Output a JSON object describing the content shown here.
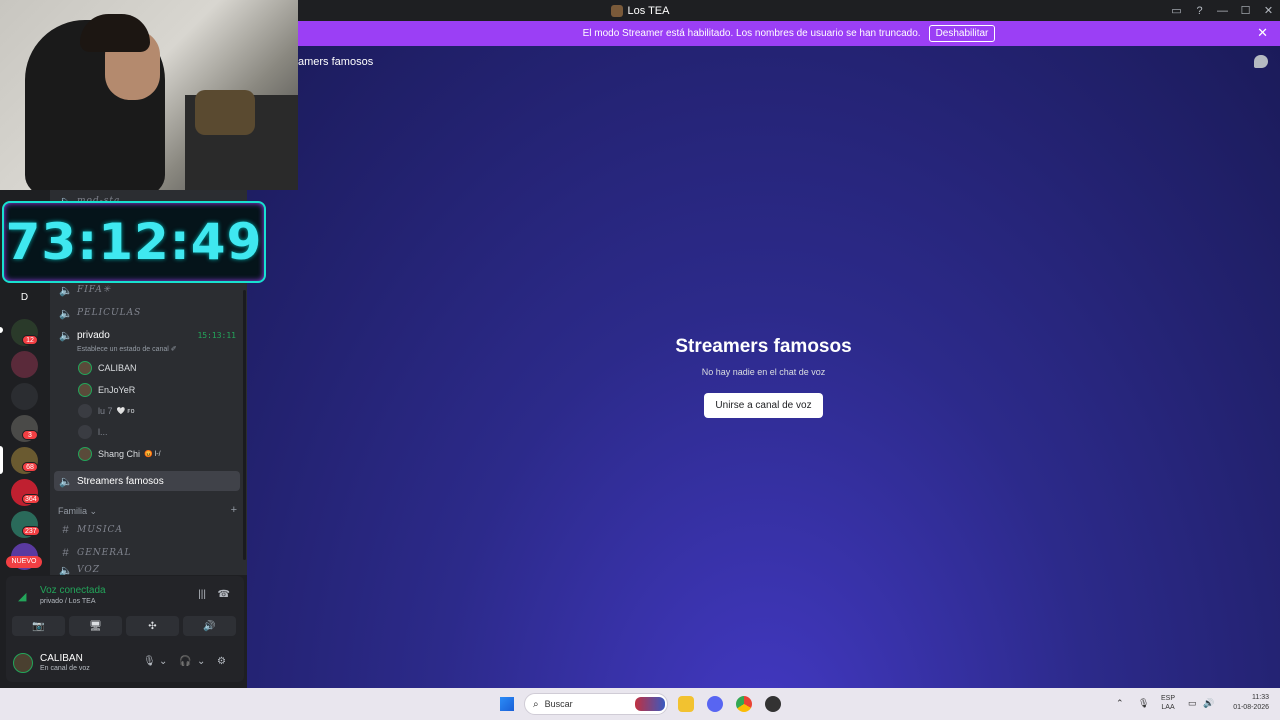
{
  "window": {
    "title": "Los TEA",
    "controls": [
      "▭",
      "?",
      "—",
      "☐",
      "✕"
    ]
  },
  "banner": {
    "message": "El modo Streamer está habilitado. Los nombres de usuario se han truncado.",
    "button": "Deshabilitar",
    "close": "✕"
  },
  "main": {
    "header": "amers famosos",
    "title": "Streamers famosos",
    "subtitle": "No hay nadie en el chat de voz",
    "join_button": "Unirse a canal de voz"
  },
  "rail": {
    "dm_label": "D",
    "badges": [
      "12",
      "3",
      "68",
      "364",
      "237"
    ],
    "new_label": "NUEVO"
  },
  "channels": {
    "partial_top": "mod-sta",
    "items": [
      {
        "label": "FIFA✳",
        "style": "italic"
      },
      {
        "label": "PELICULAS",
        "style": "italic"
      }
    ],
    "privado": {
      "label": "privado",
      "time": "15:13:11",
      "status": "Establece un estado de canal ✐",
      "members": [
        {
          "name": "CALIBAN",
          "extra": ""
        },
        {
          "name": "EnJoYeR",
          "extra": ""
        },
        {
          "name": "lu 7",
          "extra": "🤍 ꜰᴏ"
        },
        {
          "name": "l...",
          "extra": ""
        },
        {
          "name": "Shang Chi",
          "extra": "😡 l-/"
        }
      ]
    },
    "active": "Streamers famosos",
    "category": {
      "label": "Familia ⌄",
      "add": "+"
    },
    "text_channels": [
      "MUSICA",
      "GENERAL"
    ],
    "partial_bottom": "VOZ"
  },
  "voice_panel": {
    "title": "Voz conectada",
    "subtitle": "privado / Los TEA",
    "buttons": [
      "📷",
      "🖥",
      "✣",
      "🔊"
    ]
  },
  "user_panel": {
    "name": "CALIBAN",
    "status": "En canal de voz",
    "icons": [
      "🎙",
      "⌄",
      "🎧",
      "⌄",
      "⚙"
    ]
  },
  "overlay": {
    "timer": "73:12:49"
  },
  "taskbar": {
    "search_label": "Buscar",
    "lang_top": "ESP",
    "lang_bottom": "LAA",
    "time": "11:33",
    "date": "01-08-2026"
  }
}
